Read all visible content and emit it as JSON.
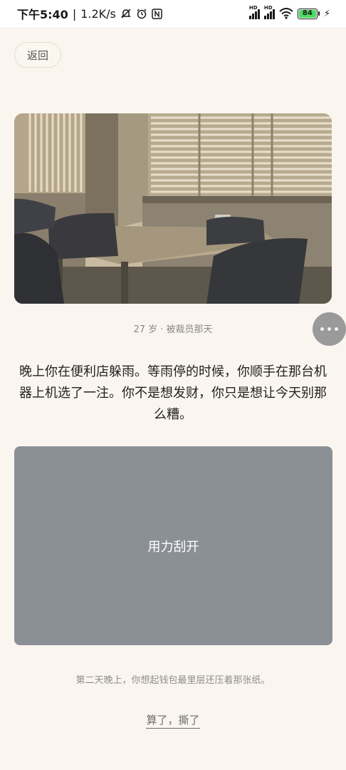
{
  "status_bar": {
    "time": "下午5:40",
    "net_speed": "1.2K/s",
    "sim1_label": "HD",
    "sim2_label": "HD",
    "battery_level": "84",
    "icons": [
      "mute-icon",
      "alarm-icon",
      "nfc-icon",
      "signal-icon",
      "wifi-icon",
      "battery-icon",
      "charging-icon"
    ]
  },
  "header": {
    "back_label": "返回"
  },
  "scene": {
    "caption": "27 岁 · 被裁员那天"
  },
  "story": {
    "text": "晚上你在便利店躲雨。等雨停的时候，你顺手在那台机器上机选了一注。你不是想发财，你只是想让今天别那么糟。"
  },
  "scratch_card": {
    "label": "用力刮开"
  },
  "footer": {
    "hint": "第二天晚上，你想起钱包最里层还压着那张纸。",
    "tear_label": "算了，撕了"
  }
}
